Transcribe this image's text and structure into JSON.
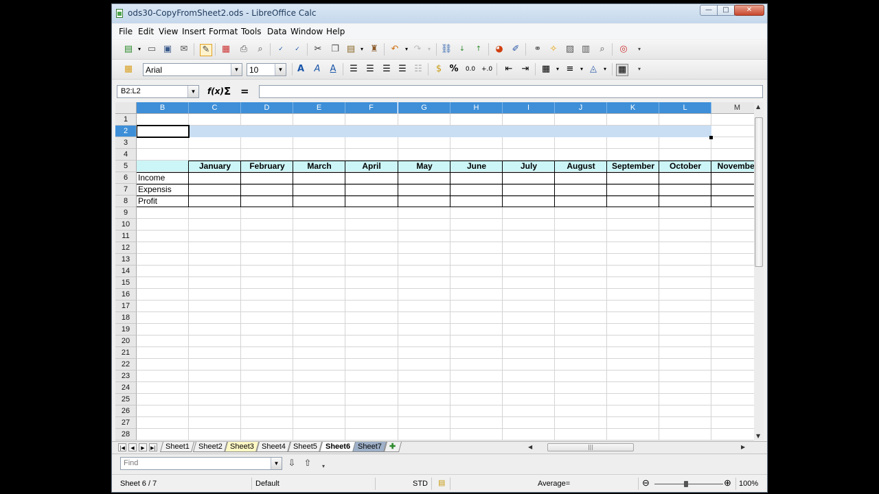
{
  "window": {
    "title": "ods30-CopyFromSheet2.ods - LibreOffice Calc",
    "controls": {
      "minimize": "—",
      "maximize": "□",
      "close": "✕"
    }
  },
  "menu": [
    "File",
    "Edit",
    "View",
    "Insert",
    "Format",
    "Tools",
    "Data",
    "Window",
    "Help"
  ],
  "formatting": {
    "font_name": "Arial",
    "font_size": "10"
  },
  "formula_bar": {
    "name_box": "B2:L2",
    "fx_label": "f(x)",
    "sum_label": "Σ",
    "equals_label": "=",
    "input_value": ""
  },
  "grid": {
    "columns": [
      "B",
      "C",
      "D",
      "E",
      "F",
      "G",
      "H",
      "I",
      "J",
      "K",
      "L",
      "M"
    ],
    "selected_columns": [
      "B",
      "C",
      "D",
      "E",
      "F",
      "G",
      "H",
      "I",
      "J",
      "K",
      "L"
    ],
    "rows": [
      "1",
      "2",
      "3",
      "4",
      "5",
      "6",
      "7",
      "8",
      "9",
      "10",
      "11",
      "12",
      "13",
      "14",
      "15",
      "16",
      "17",
      "18",
      "19",
      "20",
      "21",
      "22",
      "23",
      "24",
      "25",
      "26",
      "27",
      "28"
    ],
    "selected_row": "2",
    "months": [
      "January",
      "February",
      "March",
      "April",
      "May",
      "June",
      "July",
      "August",
      "September",
      "October",
      "November"
    ],
    "row_labels": [
      "Income",
      "Expensis",
      "Profit"
    ]
  },
  "sheet_tabs": [
    "Sheet1",
    "Sheet2",
    "Sheet3",
    "Sheet4",
    "Sheet5",
    "Sheet6",
    "Sheet7"
  ],
  "active_sheet": "Sheet6",
  "find_bar": {
    "placeholder": "Find"
  },
  "status_bar": {
    "sheet": "Sheet 6 / 7",
    "page_style": "Default",
    "selection_mode": "STD",
    "summary": "Average=",
    "zoom": "100%",
    "zoom_minus": "⊖",
    "zoom_plus": "⊕"
  },
  "colors": {
    "selection_header": "#3e8fd8",
    "selection_range": "#c9def3",
    "header_band": "#ccf5f7"
  }
}
